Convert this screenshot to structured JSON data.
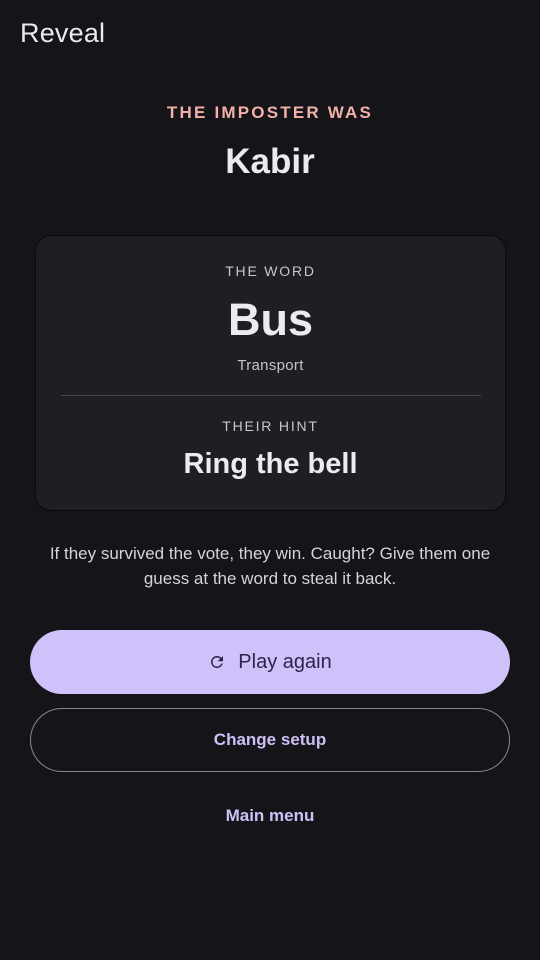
{
  "header": {
    "title": "Reveal"
  },
  "result": {
    "label": "THE IMPOSTER WAS",
    "imposter_name": "Kabir"
  },
  "card": {
    "word_label": "THE WORD",
    "word": "Bus",
    "category": "Transport",
    "hint_label": "THEIR HINT",
    "hint": "Ring the bell"
  },
  "explanation": "If they survived the vote, they win. Caught? Give them one guess at the word to steal it back.",
  "actions": {
    "play_again_label": "Play again",
    "play_again_icon": "refresh-icon",
    "change_setup_label": "Change setup",
    "main_menu_label": "Main menu"
  },
  "colors": {
    "background": "#151419",
    "accent_salmon": "#f2b1a8",
    "primary_button": "#cfc1fa",
    "link_lavender": "#cdc0f7",
    "card_background": "#1f1e23"
  }
}
